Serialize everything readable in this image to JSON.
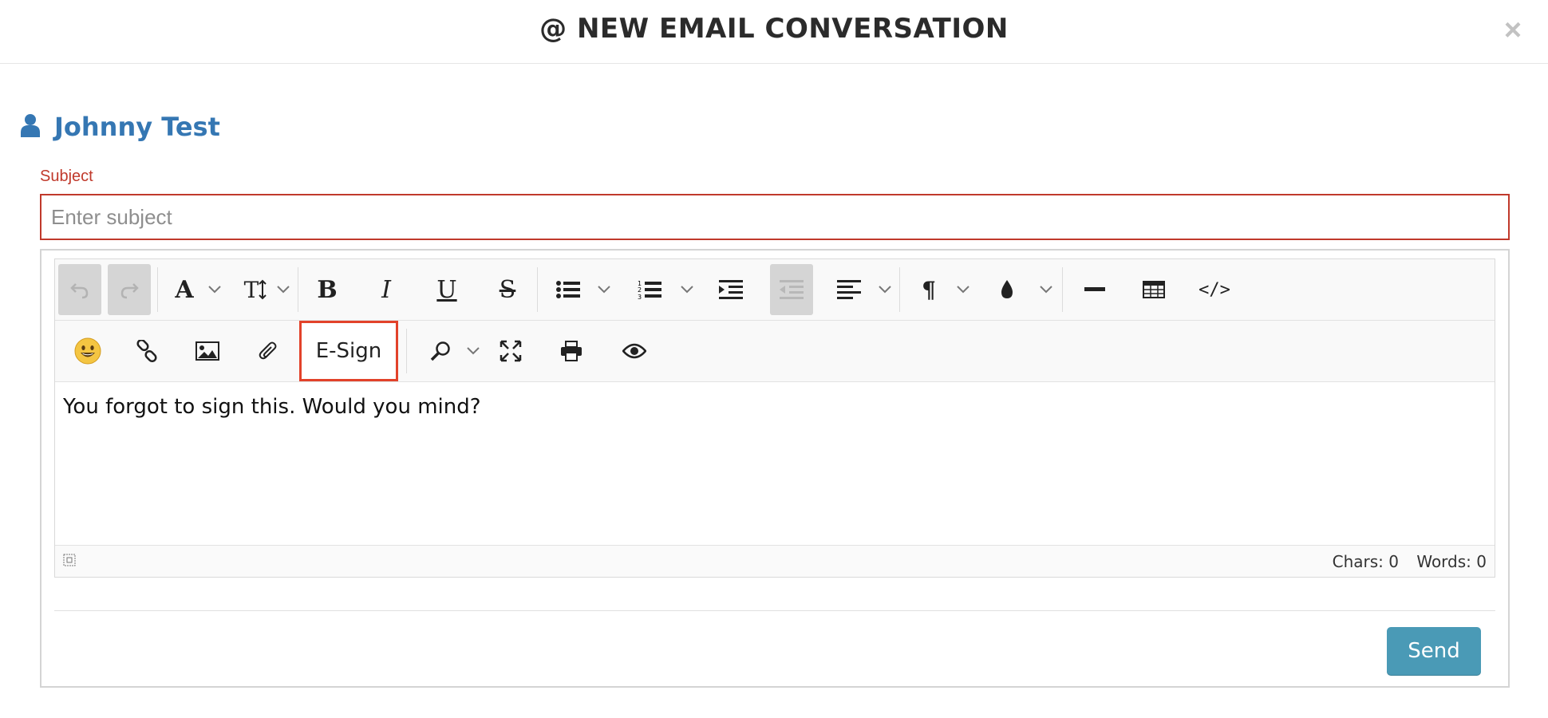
{
  "header": {
    "title": "@ NEW EMAIL CONVERSATION",
    "close_glyph": "×"
  },
  "recipient": {
    "icon": "user-icon",
    "name": "Johnny Test",
    "color": "#3577b3"
  },
  "subject": {
    "label": "Subject",
    "placeholder": "Enter subject",
    "value": "",
    "error_color": "#c0392b"
  },
  "toolbar": {
    "row1": [
      {
        "icon": "undo-icon",
        "state": "disabled"
      },
      {
        "icon": "redo-icon",
        "state": "disabled"
      },
      {
        "icon": "font-family-icon",
        "dropdown": true
      },
      {
        "icon": "font-size-icon",
        "dropdown": true
      },
      {
        "icon": "bold-icon"
      },
      {
        "icon": "italic-icon"
      },
      {
        "icon": "underline-icon"
      },
      {
        "icon": "strikethrough-icon"
      },
      {
        "icon": "bulleted-list-icon",
        "dropdown": true
      },
      {
        "icon": "numbered-list-icon",
        "dropdown": true
      },
      {
        "icon": "indent-icon"
      },
      {
        "icon": "outdent-icon",
        "state": "disabled"
      },
      {
        "icon": "align-icon",
        "dropdown": true
      },
      {
        "icon": "paragraph-format-icon",
        "dropdown": true
      },
      {
        "icon": "color-icon",
        "dropdown": true
      },
      {
        "icon": "horizontal-line-icon"
      },
      {
        "icon": "table-icon"
      },
      {
        "icon": "code-view-icon"
      }
    ],
    "row2": [
      {
        "icon": "emoji-icon"
      },
      {
        "icon": "link-icon"
      },
      {
        "icon": "image-icon"
      },
      {
        "icon": "attachment-icon"
      },
      {
        "label": "E-Sign",
        "highlighted": true
      },
      {
        "icon": "search-icon",
        "dropdown": true
      },
      {
        "icon": "fullscreen-icon"
      },
      {
        "icon": "print-icon"
      },
      {
        "icon": "preview-icon"
      }
    ],
    "glyphs": {
      "font_family": "A",
      "font_size": "T",
      "bold": "B",
      "italic": "I",
      "underline": "U",
      "strike": "S",
      "paragraph": "¶",
      "code": "</>"
    }
  },
  "editor": {
    "body_text": "You forgot to sign this. Would you mind?",
    "chars_label": "Chars: 0",
    "words_label": "Words: 0"
  },
  "actions": {
    "send_label": "Send",
    "send_color": "#4a9ab6"
  },
  "colors": {
    "highlight_border": "#e2422a"
  }
}
